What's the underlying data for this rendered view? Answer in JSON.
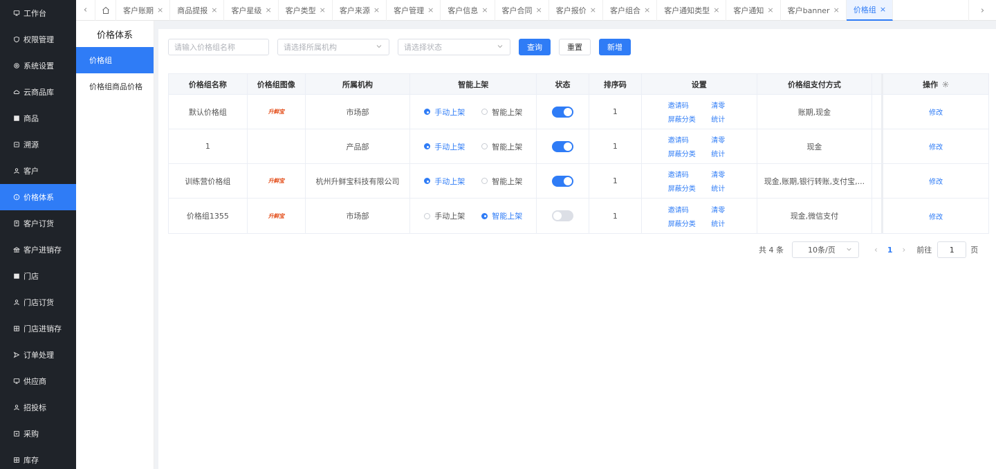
{
  "sidebar": {
    "items": [
      {
        "label": "工作台",
        "icon": "monitor-icon"
      },
      {
        "label": "权限管理",
        "icon": "shield-icon"
      },
      {
        "label": "系统设置",
        "icon": "gear-icon"
      },
      {
        "label": "云商品库",
        "icon": "cloud-icon"
      },
      {
        "label": "商品",
        "icon": "box-icon"
      },
      {
        "label": "溯源",
        "icon": "trace-icon"
      },
      {
        "label": "客户",
        "icon": "user-icon"
      },
      {
        "label": "价格体系",
        "icon": "info-circle-icon"
      },
      {
        "label": "客户订货",
        "icon": "order-icon"
      },
      {
        "label": "客户进销存",
        "icon": "bank-icon"
      },
      {
        "label": "门店",
        "icon": "store-icon"
      },
      {
        "label": "门店订货",
        "icon": "user-icon"
      },
      {
        "label": "门店进销存",
        "icon": "grid-icon"
      },
      {
        "label": "订单处理",
        "icon": "send-icon"
      },
      {
        "label": "供应商",
        "icon": "monitor-icon"
      },
      {
        "label": "招投标",
        "icon": "user-icon"
      },
      {
        "label": "采购",
        "icon": "cart-icon"
      },
      {
        "label": "库存",
        "icon": "grid-icon"
      }
    ],
    "active_index": 7
  },
  "tabs": [
    {
      "label": "客户账期"
    },
    {
      "label": "商品提报"
    },
    {
      "label": "客户星级"
    },
    {
      "label": "客户类型"
    },
    {
      "label": "客户来源"
    },
    {
      "label": "客户管理"
    },
    {
      "label": "客户信息"
    },
    {
      "label": "客户合同"
    },
    {
      "label": "客户报价"
    },
    {
      "label": "客户组合"
    },
    {
      "label": "客户通知类型"
    },
    {
      "label": "客户通知"
    },
    {
      "label": "客户banner"
    },
    {
      "label": "价格组"
    }
  ],
  "tab_close": "×",
  "submenu": {
    "title": "价格体系",
    "items": [
      {
        "label": "价格组"
      },
      {
        "label": "价格组商品价格"
      }
    ]
  },
  "filters": {
    "name_placeholder": "请输入价格组名称",
    "org_placeholder": "请选择所属机构",
    "status_placeholder": "请选择状态",
    "query_label": "查询",
    "reset_label": "重置",
    "add_label": "新增"
  },
  "table": {
    "headers": [
      "价格组名称",
      "价格组图像",
      "所属机构",
      "智能上架",
      "状态",
      "排序码",
      "设置",
      "价格组支付方式",
      "",
      "操作"
    ],
    "radio_manual": "手动上架",
    "radio_smart": "智能上架",
    "setting_links": [
      "邀请码",
      "清零",
      "屏蔽分类",
      "统计"
    ],
    "edit_label": "修改",
    "logo_text": "升鲜宝",
    "rows": [
      {
        "name": "默认价格组",
        "has_logo": true,
        "org": "市场部",
        "shelf": "manual",
        "enabled": true,
        "sort": "1",
        "pay": "账期,现金"
      },
      {
        "name": "1",
        "has_logo": false,
        "org": "产品部",
        "shelf": "manual",
        "enabled": true,
        "sort": "1",
        "pay": "现金"
      },
      {
        "name": "训练营价格组",
        "has_logo": true,
        "org": "杭州升鲜宝科技有限公司",
        "shelf": "manual",
        "enabled": true,
        "sort": "1",
        "pay": "现金,账期,银行转账,支付宝,..."
      },
      {
        "name": "价格组1355",
        "has_logo": true,
        "org": "市场部",
        "shelf": "smart",
        "enabled": false,
        "sort": "1",
        "pay": "现金,微信支付"
      }
    ]
  },
  "pagination": {
    "total": "共 4 条",
    "page_size": "10条/页",
    "current": "1",
    "goto_label": "前往",
    "goto_value": "1",
    "page_suffix": "页"
  }
}
